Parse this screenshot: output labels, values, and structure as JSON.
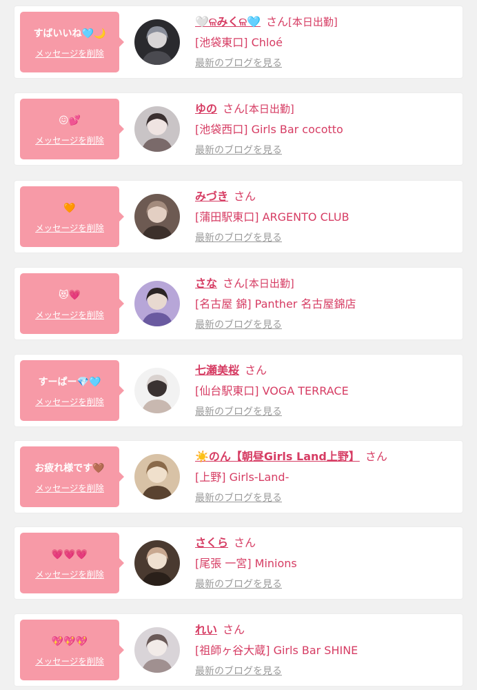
{
  "delete_label": "メッセージを削除",
  "honorific": "さん",
  "blog_label": "最新のブログを見る",
  "colors": {
    "accent": "#d63c63",
    "bubble": "#f79aa7",
    "background": "#f1f1f1",
    "link_gray": "#9a9a9a"
  },
  "cards": [
    {
      "message": "すばいいね🩵🌙",
      "name": "🤍ଳみくଳ🩵",
      "status": "[本日出勤]",
      "shop": "[池袋東口] Chloé",
      "avatar_icon": "avatar-photo-icon"
    },
    {
      "message": "😖💕",
      "name": "ゆの",
      "status": "[本日出勤]",
      "shop": "[池袋西口] Girls Bar cocotto",
      "avatar_icon": "avatar-photo-icon"
    },
    {
      "message": "🧡",
      "name": "みづき",
      "status": "",
      "shop": "[蒲田駅東口] ARGENTO CLUB",
      "avatar_icon": "avatar-photo-icon"
    },
    {
      "message": "😻💗",
      "name": "さな",
      "status": "[本日出勤]",
      "shop": "[名古屋 錦] Panther 名古屋錦店",
      "avatar_icon": "avatar-photo-icon"
    },
    {
      "message": "すーぱー💎🩵",
      "name": "七瀬美桜",
      "status": "",
      "shop": "[仙台駅東口] VOGA TERRACE",
      "avatar_icon": "avatar-photo-icon"
    },
    {
      "message": "お疲れ様です🤎",
      "name": "☀️のん【朝昼Girls Land上野】",
      "status": "",
      "shop": "[上野] Girls-Land-",
      "avatar_icon": "avatar-photo-icon"
    },
    {
      "message": "💗💗💗",
      "name": "さくら",
      "status": "",
      "shop": "[尾張 一宮] Minions",
      "avatar_icon": "avatar-photo-icon"
    },
    {
      "message": "💖💖💖",
      "name": "れい",
      "status": "",
      "shop": "[祖師ヶ谷大蔵] Girls Bar SHINE",
      "avatar_icon": "avatar-photo-icon"
    }
  ]
}
